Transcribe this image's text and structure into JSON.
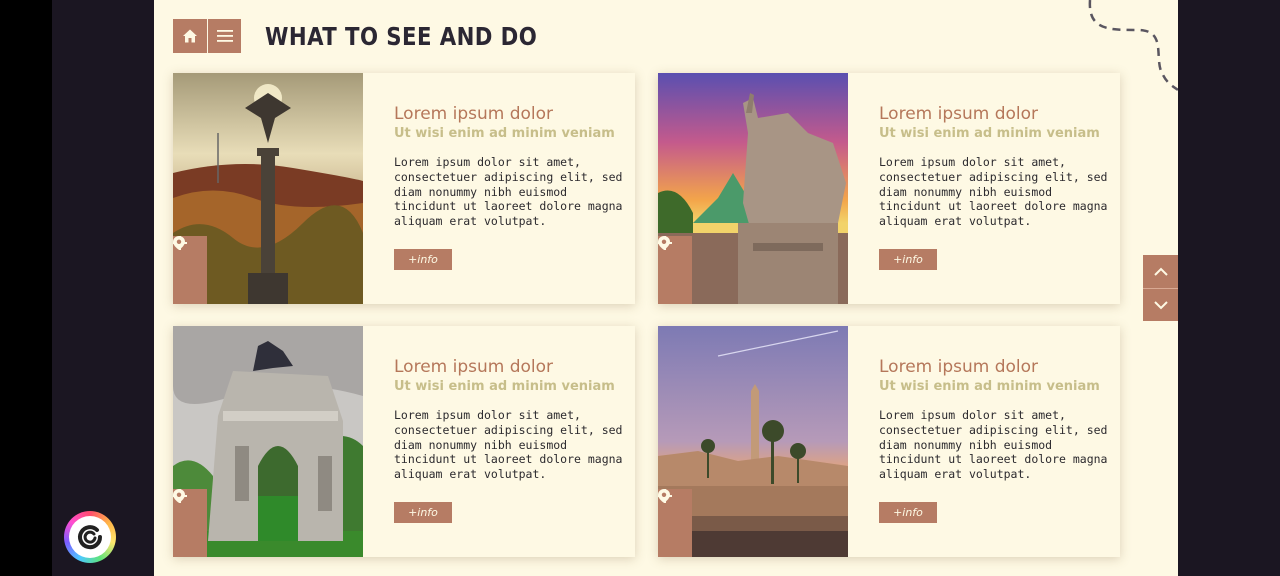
{
  "page": {
    "title": "WHAT TO SEE AND DO"
  },
  "nav": {
    "home_icon": "home-icon",
    "menu_icon": "hamburger-menu-icon"
  },
  "cards": [
    {
      "title": "Lorem ipsum dolor",
      "subtitle": "Ut wisi enim ad minim veniam",
      "text": "Lorem ipsum dolor sit amet, consectetuer adipiscing elit, sed diam nonummy nibh euismod tincidunt ut laoreet dolore magna aliquam erat volutpat.",
      "button": "+info",
      "image": "angel monument on tall column above autumn forest"
    },
    {
      "title": "Lorem ipsum dolor",
      "subtitle": "Ut wisi enim ad minim veniam",
      "text": "Lorem ipsum dolor sit amet, consectetuer adipiscing elit, sed diam nonummy nibh euismod tincidunt ut laoreet dolore magna aliquam erat volutpat.",
      "button": "+info",
      "image": "stone statue of figure with horse at sunset with green bridge"
    },
    {
      "title": "Lorem ipsum dolor",
      "subtitle": "Ut wisi enim ad minim veniam",
      "text": "Lorem ipsum dolor sit amet, consectetuer adipiscing elit, sed diam nonummy nibh euismod tincidunt ut laoreet dolore magna aliquam erat volutpat.",
      "button": "+info",
      "image": "stone triumphal arch with equestrian statue on top"
    },
    {
      "title": "Lorem ipsum dolor",
      "subtitle": "Ut wisi enim ad minim veniam",
      "text": "Lorem ipsum dolor sit amet, consectetuer adipiscing elit, sed diam nonummy nibh euismod tincidunt ut laoreet dolore magna aliquam erat volutpat.",
      "button": "+info",
      "image": "ancient temple ruins with obelisk and palm trees"
    }
  ],
  "colors": {
    "accent": "#b67c64",
    "background": "#fef9e4",
    "title": "#2b2733",
    "card_title": "#b5775a",
    "card_subtitle": "#c7be8a"
  }
}
